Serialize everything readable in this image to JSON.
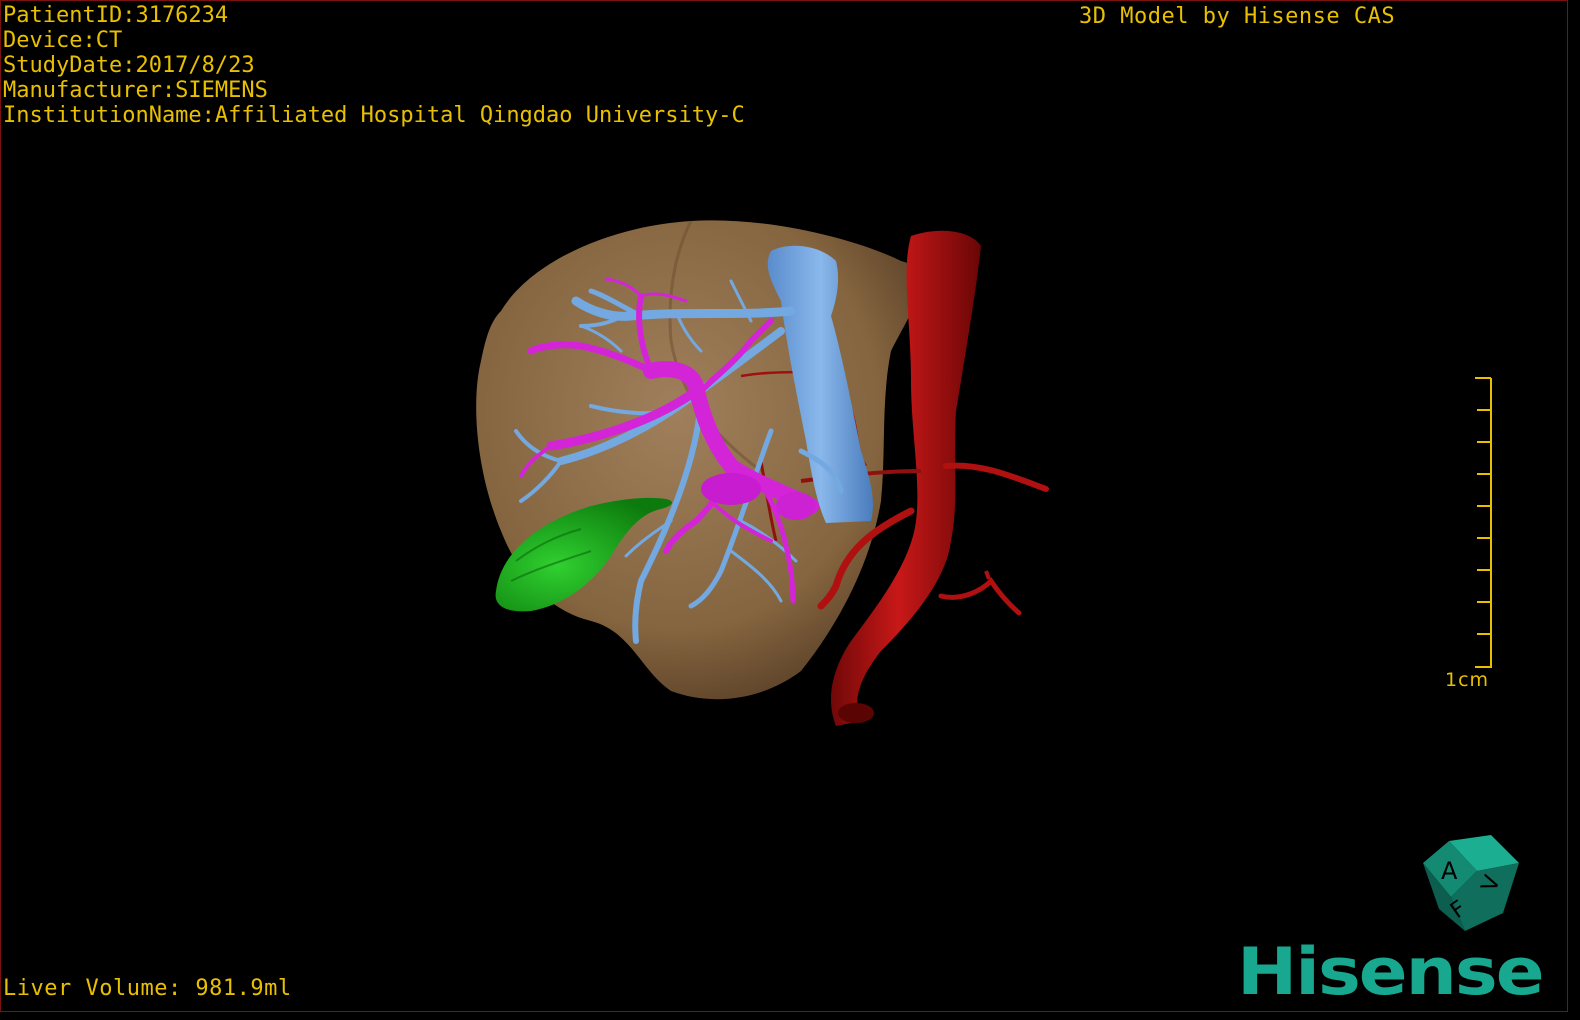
{
  "metadata": {
    "patient_id": "PatientID:3176234",
    "device": "Device:CT",
    "study_date": "StudyDate:2017/8/23",
    "manufacturer": "Manufacturer:SIEMENS",
    "institution": "InstitutionName:Affiliated Hospital Qingdao University-C"
  },
  "branding": "3D Model by Hisense CAS",
  "volume_label": "Liver Volume: 981.9ml",
  "scale": {
    "label": "1cm",
    "tick_count": 10
  },
  "orientation_cube": {
    "labels": [
      "A",
      "F",
      "V"
    ]
  },
  "logo_text": "Hisense",
  "colors": {
    "overlay_text": "#e8c000",
    "liver": "#8a6a48",
    "hepatic_vein": "#6aa0dc",
    "portal_vein": "#d020d8",
    "artery": "#b01010",
    "gallbladder": "#18a818",
    "logo": "#17a88f"
  },
  "structures": [
    {
      "name": "liver",
      "icon": "liver-surface"
    },
    {
      "name": "hepatic-vein",
      "icon": "vessel-tree"
    },
    {
      "name": "portal-vein",
      "icon": "vessel-tree"
    },
    {
      "name": "aorta",
      "icon": "vessel"
    },
    {
      "name": "gallbladder",
      "icon": "organ"
    }
  ]
}
